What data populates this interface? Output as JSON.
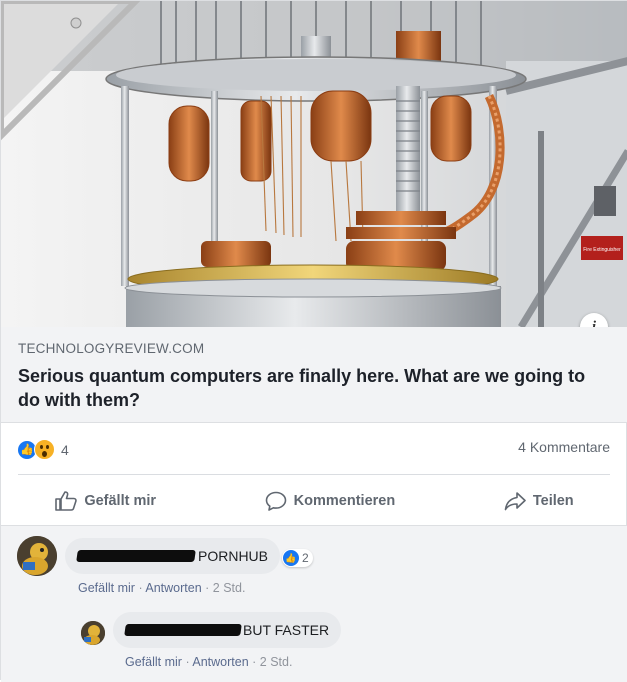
{
  "link": {
    "domain": "TECHNOLOGYREVIEW.COM",
    "title": "Serious quantum computers are finally here. What are we going to do with them?",
    "info_glyph": "i"
  },
  "stats": {
    "reaction_count": "4",
    "comment_count": "4 Kommentare",
    "reaction_icons": [
      "like-icon",
      "wow-icon"
    ]
  },
  "actions": {
    "like": "Gefällt mir",
    "comment": "Kommentieren",
    "share": "Teilen"
  },
  "comments": [
    {
      "author_redacted": true,
      "text": "PORNHUB",
      "like_count": "2",
      "meta": {
        "like": "Gefällt mir",
        "reply": "Antworten",
        "time": "2 Std."
      }
    },
    {
      "author_redacted": true,
      "text": "BUT FASTER",
      "meta": {
        "like": "Gefällt mir",
        "reply": "Antworten",
        "time": "2 Std."
      }
    }
  ],
  "colors": {
    "accent": "#1877f2",
    "copper": "#c46a2f",
    "link_box": "#f2f3f5"
  },
  "image_label": "Fire Extinguisher"
}
